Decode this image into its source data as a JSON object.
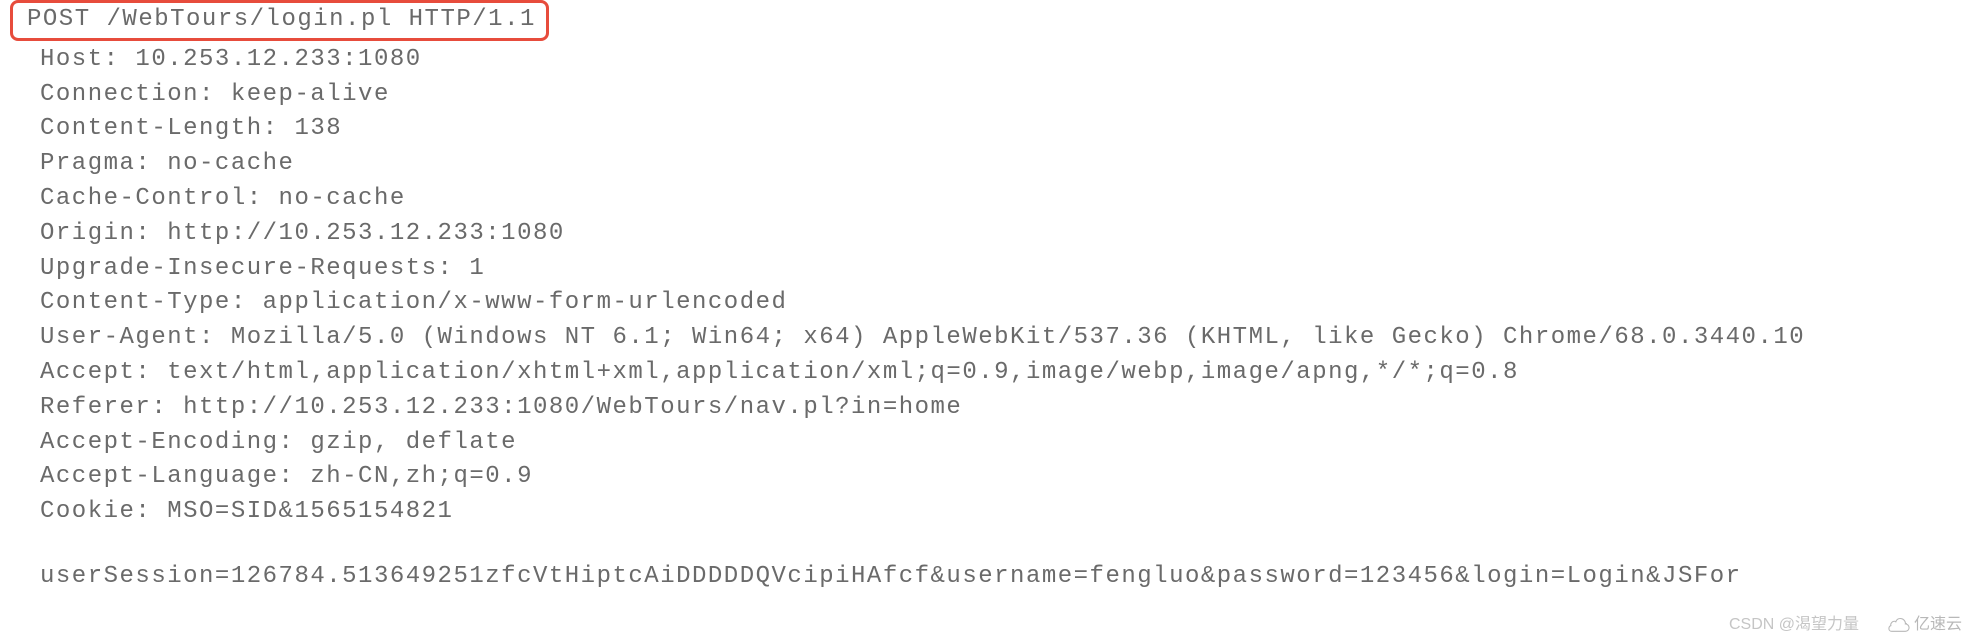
{
  "http": {
    "request_line": "POST /WebTours/login.pl HTTP/1.1",
    "headers": [
      "Host: 10.253.12.233:1080",
      "Connection: keep-alive",
      "Content-Length: 138",
      "Pragma: no-cache",
      "Cache-Control: no-cache",
      "Origin: http://10.253.12.233:1080",
      "Upgrade-Insecure-Requests: 1",
      "Content-Type: application/x-www-form-urlencoded",
      "User-Agent: Mozilla/5.0 (Windows NT 6.1; Win64; x64) AppleWebKit/537.36 (KHTML, like Gecko) Chrome/68.0.3440.10",
      "Accept: text/html,application/xhtml+xml,application/xml;q=0.9,image/webp,image/apng,*/*;q=0.8",
      "Referer: http://10.253.12.233:1080/WebTours/nav.pl?in=home",
      "Accept-Encoding: gzip, deflate",
      "Accept-Language: zh-CN,zh;q=0.9",
      "Cookie: MSO=SID&1565154821"
    ],
    "body": "userSession=126784.513649251zfcVtHiptcAiDDDDDQVcipiHAfcf&username=fengluo&password=123456&login=Login&JSFor"
  },
  "watermark": {
    "csdn": "CSDN @渴望力量",
    "cloud": "亿速云"
  }
}
